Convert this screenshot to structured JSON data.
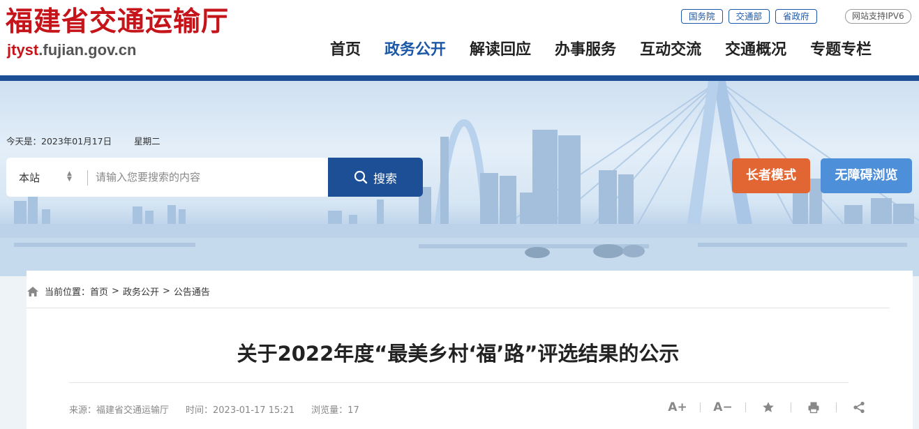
{
  "header": {
    "site_title": "福建省交通运输厅",
    "domain_prefix": "jtyst",
    "domain_suffix": ".fujian.gov.cn",
    "top_links": [
      "国务院",
      "交通部",
      "省政府"
    ],
    "ipv6_badge": "网站支持IPV6",
    "nav": [
      "首页",
      "政务公开",
      "解读回应",
      "办事服务",
      "互动交流",
      "交通概况",
      "专题专栏"
    ],
    "active_nav": "政务公开"
  },
  "banner": {
    "date_label": "今天是：2023年01月17日",
    "weekday": "星期二",
    "search": {
      "scope": "本站",
      "placeholder": "请输入您要搜索的内容",
      "button_label": "搜索"
    },
    "elder_mode_label": "长者模式",
    "accessible_label": "无障碍浏览"
  },
  "breadcrumb": {
    "prefix": "当前位置：",
    "items": [
      "首页",
      "政务公开",
      "公告通告"
    ],
    "separator": ">"
  },
  "article": {
    "title": "关于2022年度“最美乡村‘福’路”评选结果的公示",
    "source": "来源：福建省交通运输厅",
    "time": "时间：2023-01-17 15:21",
    "views": "浏览量：17"
  },
  "tools": {
    "font_larger": "A+",
    "font_smaller": "A−"
  },
  "colors": {
    "brand_red": "#c5151a",
    "brand_blue": "#1c4f96",
    "nav_active": "#1c58a8",
    "elder_orange": "#e26633",
    "access_blue": "#4d8fd8"
  }
}
